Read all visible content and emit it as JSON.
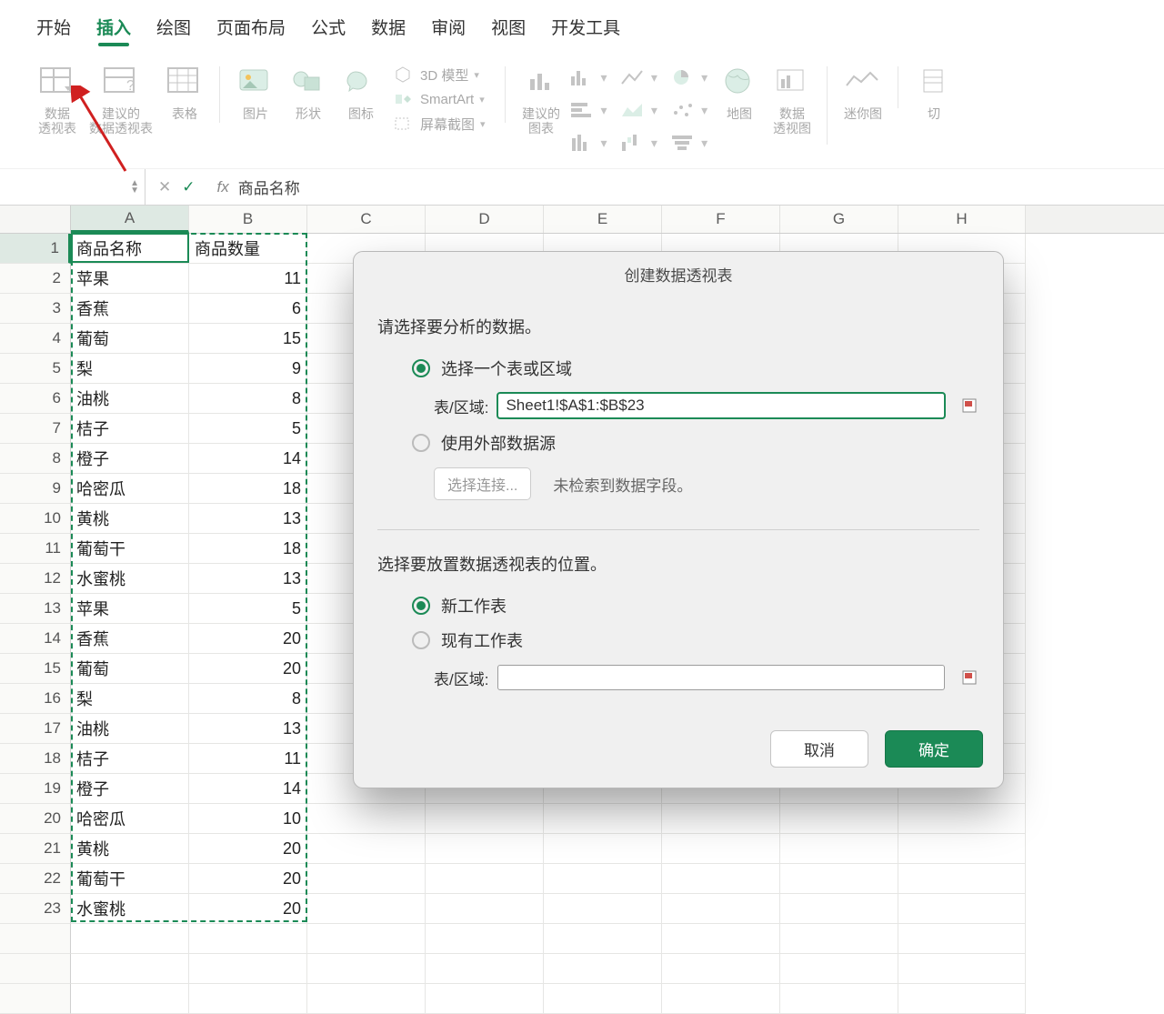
{
  "tabs": {
    "home": "开始",
    "insert": "插入",
    "draw": "绘图",
    "layout": "页面布局",
    "formulas": "公式",
    "data": "数据",
    "review": "审阅",
    "view": "视图",
    "dev": "开发工具"
  },
  "ribbon": {
    "pivot": "数据\n透视表",
    "recPivot": "建议的\n数据透视表",
    "table": "表格",
    "picture": "图片",
    "shapes": "形状",
    "icons": "图标",
    "model3d": "3D 模型",
    "smartart": "SmartArt",
    "screenshot": "屏幕截图",
    "recChart": "建议的\n图表",
    "map": "地图",
    "pivotChart": "数据\n透视图",
    "sparkline": "迷你图",
    "slicer": "切"
  },
  "formula": {
    "fx": "fx",
    "value": "商品名称"
  },
  "columns": [
    "A",
    "B",
    "C",
    "D",
    "E",
    "F",
    "G",
    "H"
  ],
  "rows": [
    {
      "n": "1",
      "a": "商品名称",
      "b": "商品数量"
    },
    {
      "n": "2",
      "a": "苹果",
      "b": "11"
    },
    {
      "n": "3",
      "a": "香蕉",
      "b": "6"
    },
    {
      "n": "4",
      "a": "葡萄",
      "b": "15"
    },
    {
      "n": "5",
      "a": "梨",
      "b": "9"
    },
    {
      "n": "6",
      "a": "油桃",
      "b": "8"
    },
    {
      "n": "7",
      "a": "桔子",
      "b": "5"
    },
    {
      "n": "8",
      "a": "橙子",
      "b": "14"
    },
    {
      "n": "9",
      "a": "哈密瓜",
      "b": "18"
    },
    {
      "n": "10",
      "a": "黄桃",
      "b": "13"
    },
    {
      "n": "11",
      "a": "葡萄干",
      "b": "18"
    },
    {
      "n": "12",
      "a": "水蜜桃",
      "b": "13"
    },
    {
      "n": "13",
      "a": "苹果",
      "b": "5"
    },
    {
      "n": "14",
      "a": "香蕉",
      "b": "20"
    },
    {
      "n": "15",
      "a": "葡萄",
      "b": "20"
    },
    {
      "n": "16",
      "a": "梨",
      "b": "8"
    },
    {
      "n": "17",
      "a": "油桃",
      "b": "13"
    },
    {
      "n": "18",
      "a": "桔子",
      "b": "11"
    },
    {
      "n": "19",
      "a": "橙子",
      "b": "14"
    },
    {
      "n": "20",
      "a": "哈密瓜",
      "b": "10"
    },
    {
      "n": "21",
      "a": "黄桃",
      "b": "20"
    },
    {
      "n": "22",
      "a": "葡萄干",
      "b": "20"
    },
    {
      "n": "23",
      "a": "水蜜桃",
      "b": "20"
    }
  ],
  "dialog": {
    "title": "创建数据透视表",
    "section1": "请选择要分析的数据。",
    "opt_range": "选择一个表或区域",
    "range_label": "表/区域:",
    "range_value": "Sheet1!$A$1:$B$23",
    "opt_external": "使用外部数据源",
    "choose_conn": "选择连接...",
    "no_fields": "未检索到数据字段。",
    "section2": "选择要放置数据透视表的位置。",
    "opt_new": "新工作表",
    "opt_existing": "现有工作表",
    "range_label2": "表/区域:",
    "cancel": "取消",
    "ok": "确定"
  },
  "colWidths": {
    "A": 130,
    "B": 130,
    "other": 130
  }
}
